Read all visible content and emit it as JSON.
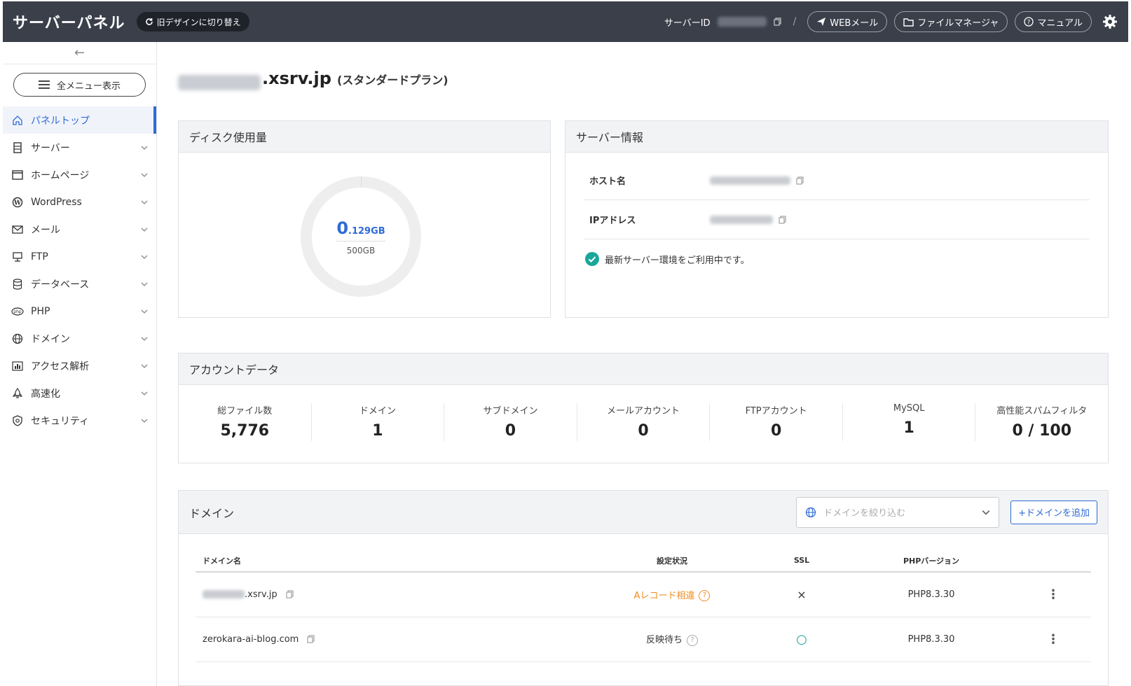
{
  "header": {
    "brand": "サーバーパネル",
    "old_design": "旧デザインに切り替え",
    "server_id_label": "サーバーID",
    "separator": "/",
    "webmail": "WEBメール",
    "file_manager": "ファイルマネージャ",
    "manual": "マニュアル"
  },
  "sidebar": {
    "collapse_arrow": "←",
    "all_menu": "全メニュー表示",
    "items": [
      {
        "label": "パネルトップ"
      },
      {
        "label": "サーバー"
      },
      {
        "label": "ホームページ"
      },
      {
        "label": "WordPress"
      },
      {
        "label": "メール"
      },
      {
        "label": "FTP"
      },
      {
        "label": "データベース"
      },
      {
        "label": "PHP"
      },
      {
        "label": "ドメイン"
      },
      {
        "label": "アクセス解析"
      },
      {
        "label": "高速化"
      },
      {
        "label": "セキュリティ"
      }
    ]
  },
  "page": {
    "title_domain": ".xsrv.jp",
    "title_plan": "(スタンダードプラン)"
  },
  "disk": {
    "heading": "ディスク使用量",
    "used_int": "0",
    "used_frac": ".129GB",
    "total": "500GB",
    "used_fraction": 0.000258
  },
  "server_info": {
    "heading": "サーバー情報",
    "host_label": "ホスト名",
    "ip_label": "IPアドレス",
    "status": "最新サーバー環境をご利用中です。"
  },
  "account": {
    "heading": "アカウントデータ",
    "stats": [
      {
        "label": "総ファイル数",
        "value": "5,776"
      },
      {
        "label": "ドメイン",
        "value": "1"
      },
      {
        "label": "サブドメイン",
        "value": "0"
      },
      {
        "label": "メールアカウント",
        "value": "0"
      },
      {
        "label": "FTPアカウント",
        "value": "0"
      },
      {
        "label": "MySQL",
        "value": "1"
      },
      {
        "label": "高性能スパムフィルタ",
        "value": "0 / 100"
      }
    ]
  },
  "domains": {
    "heading": "ドメイン",
    "filter_placeholder": "ドメインを絞り込む",
    "add_button": "+ドメインを追加",
    "columns": {
      "name": "ドメイン名",
      "status": "設定状況",
      "ssl": "SSL",
      "php": "PHPバージョン"
    },
    "rows": [
      {
        "name": ".xsrv.jp",
        "status": "Aレコード相違",
        "ssl": "×",
        "php": "PHP8.3.30"
      },
      {
        "name": "zerokara-ai-blog.com",
        "status": "反映待ち",
        "ssl": "○",
        "php": "PHP8.3.30"
      }
    ]
  },
  "colors": {
    "accent": "#2e6bd6",
    "header_bg": "#3a3f4a",
    "warning": "#f08c1e",
    "success": "#1aa79a"
  }
}
